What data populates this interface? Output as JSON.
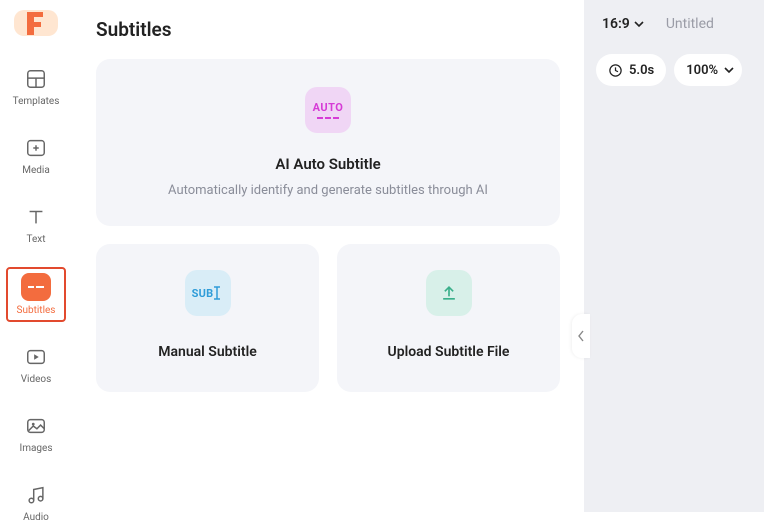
{
  "sidebar": {
    "items": [
      {
        "label": "Templates"
      },
      {
        "label": "Media"
      },
      {
        "label": "Text"
      },
      {
        "label": "Subtitles"
      },
      {
        "label": "Videos"
      },
      {
        "label": "Images"
      },
      {
        "label": "Audio"
      }
    ]
  },
  "page": {
    "title": "Subtitles"
  },
  "cards": {
    "ai_auto": {
      "badge": "AUTO",
      "title": "AI Auto Subtitle",
      "desc": "Automatically identify and generate subtitles through AI"
    },
    "manual": {
      "badge": "SUB",
      "title": "Manual Subtitle"
    },
    "upload": {
      "title": "Upload Subtitle File"
    }
  },
  "right": {
    "ratio": "16:9",
    "project_name": "Untitled",
    "duration": "5.0s",
    "zoom": "100%"
  }
}
